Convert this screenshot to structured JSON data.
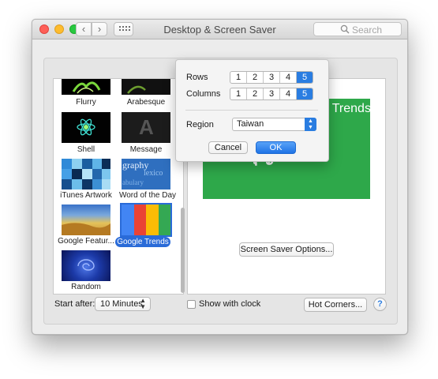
{
  "window": {
    "title": "Desktop & Screen Saver",
    "search_placeholder": "Search",
    "nav_back": "‹",
    "nav_forward": "›"
  },
  "screensavers": [
    {
      "name": "Flurry",
      "selected": false
    },
    {
      "name": "Arabesque",
      "selected": false
    },
    {
      "name": "Shell",
      "selected": false
    },
    {
      "name": "Message",
      "selected": false
    },
    {
      "name": "iTunes Artwork",
      "selected": false
    },
    {
      "name": "Word of the Day",
      "selected": false
    },
    {
      "name": "Google Featur...",
      "selected": false
    },
    {
      "name": "Google Trends",
      "selected": true
    },
    {
      "name": "Random",
      "selected": false
    }
  ],
  "thumb_text": {
    "message_letter": "A",
    "word_line1": "graphy",
    "word_line2": "lexico",
    "word_line3": "abulary"
  },
  "preview": {
    "title": "Google Trends",
    "trend_text": "เบล บุญมราช"
  },
  "controls": {
    "screen_saver_options": "Screen Saver Options...",
    "start_after_label": "Start after:",
    "start_after_value": "10 Minutes",
    "show_with_clock": "Show with clock",
    "show_with_clock_checked": false,
    "hot_corners": "Hot Corners...",
    "help": "?"
  },
  "popover": {
    "rows_label": "Rows",
    "rows_options": [
      "1",
      "2",
      "3",
      "4",
      "5"
    ],
    "rows_selected": "5",
    "columns_label": "Columns",
    "columns_options": [
      "1",
      "2",
      "3",
      "4",
      "5"
    ],
    "columns_selected": "5",
    "region_label": "Region",
    "region_value": "Taiwan",
    "cancel": "Cancel",
    "ok": "OK"
  },
  "colors": {
    "accent": "#2a7de1",
    "preview_green": "#2ea84a"
  }
}
